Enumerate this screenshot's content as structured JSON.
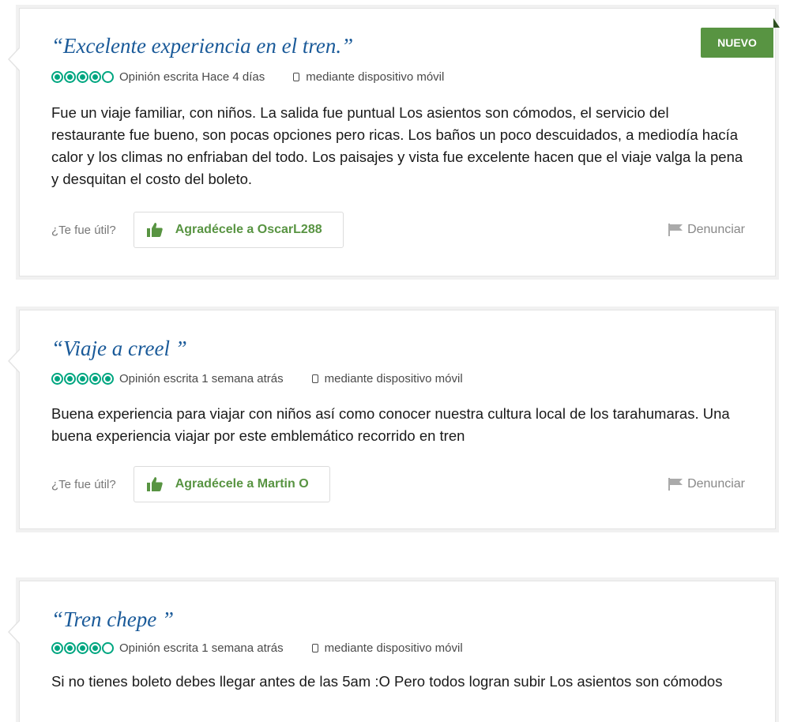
{
  "reviews": [
    {
      "title": "“Excelente experiencia en el tren.”",
      "rating": 4,
      "max_rating": 5,
      "written": "Opinión escrita Hace 4 días",
      "device": "mediante dispositivo móvil",
      "text": "Fue un viaje familiar, con niños. La salida fue puntual Los asientos son cómodos, el servicio del restaurante fue bueno, son pocas opciones pero ricas. Los baños un poco descuidados, a mediodía hacía calor y los climas no enfriaban del todo. Los paisajes y vista fue excelente hacen que el viaje valga la pena y desquitan el costo del boleto.",
      "useful_label": "¿Te fue útil?",
      "thanks_label": "Agradécele a OscarL288",
      "report_label": "Denunciar",
      "badge": "NUEVO"
    },
    {
      "title": "“Viaje a creel ”",
      "rating": 5,
      "max_rating": 5,
      "written": "Opinión escrita 1 semana atrás",
      "device": "mediante dispositivo móvil",
      "text": "Buena experiencia para viajar con niños así como conocer nuestra cultura local de los tarahumaras. Una buena experiencia viajar por este emblemático recorrido en tren",
      "useful_label": "¿Te fue útil?",
      "thanks_label": "Agradécele a Martin O",
      "report_label": "Denunciar"
    },
    {
      "title": "“Tren chepe ”",
      "rating": 4,
      "max_rating": 5,
      "written": "Opinión escrita 1 semana atrás",
      "device": "mediante dispositivo móvil",
      "text": "Si no tienes boleto debes llegar antes de las 5am :O Pero todos logran subir Los asientos son cómodos"
    }
  ],
  "colors": {
    "title": "#1a5a99",
    "rating_bubble": "#00a680",
    "thanks_green": "#589442",
    "badge_green": "#589442"
  },
  "icons": {
    "thumb": "thumbs-up-icon",
    "flag": "flag-icon",
    "mobile": "mobile-device-icon"
  }
}
